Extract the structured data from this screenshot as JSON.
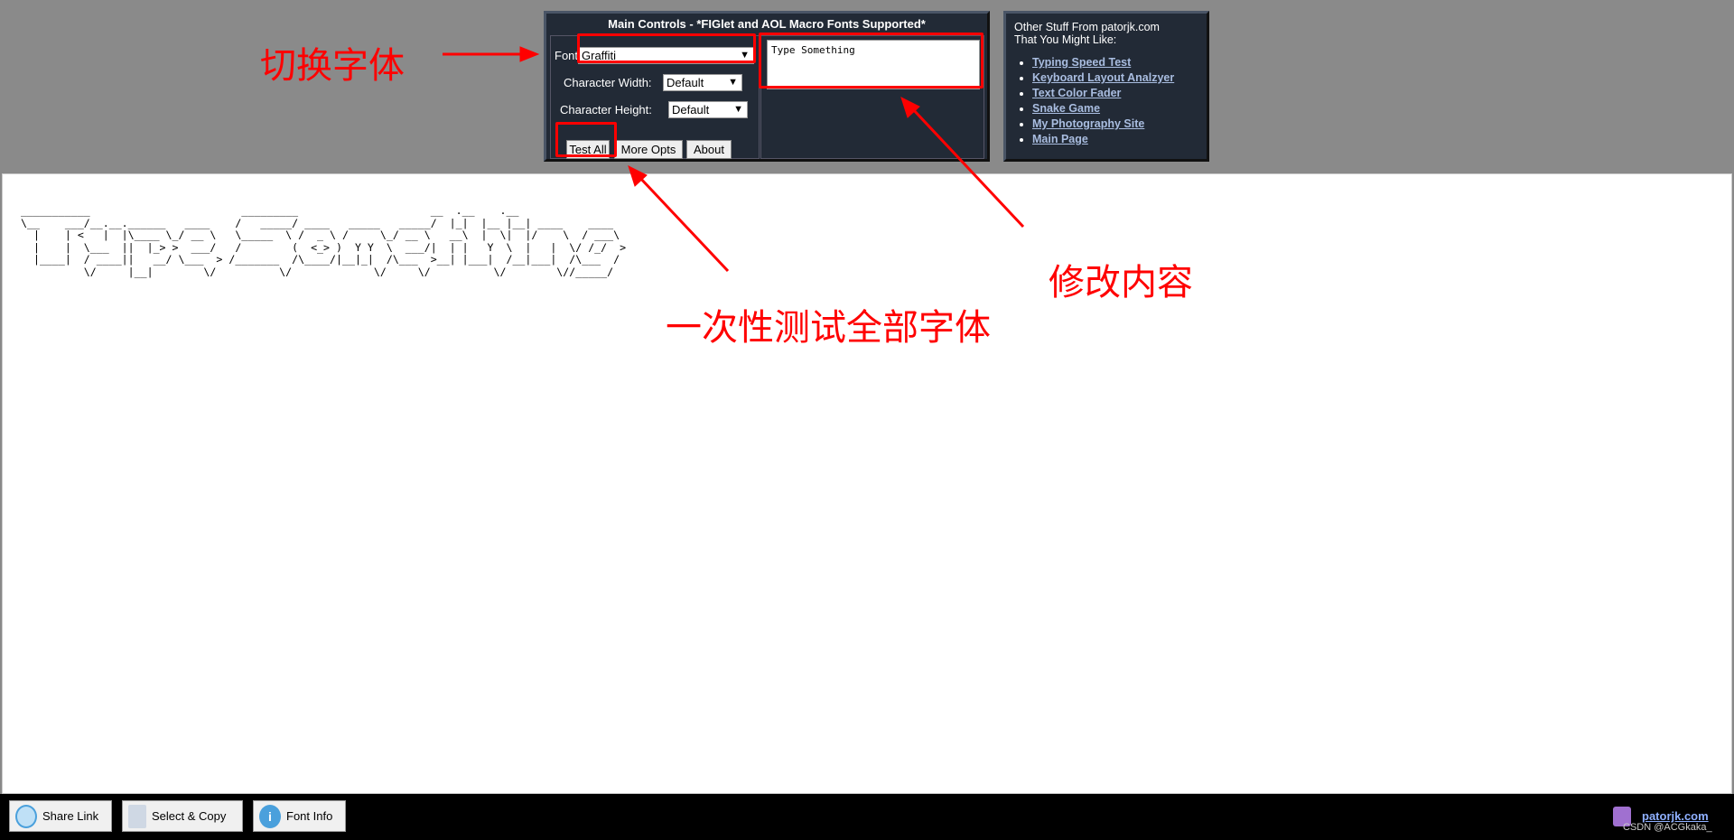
{
  "main_controls": {
    "title": "Main Controls - *FIGlet and AOL Macro Fonts Supported*",
    "font_label": "Font:",
    "font_value": "Graffiti",
    "char_width_label": "Character Width:",
    "char_width_value": "Default",
    "char_height_label": "Character Height:",
    "char_height_value": "Default",
    "buttons": [
      "Test All",
      "More Opts",
      "About"
    ],
    "input_text": "Type Something"
  },
  "other_stuff": {
    "heading_line1": "Other Stuff From patorjk.com",
    "heading_line2": "That You Might Like:",
    "links": [
      "Typing Speed Test",
      "Keyboard Layout Analzyer",
      "Text Color Fader",
      "Snake Game",
      "My Photography Site",
      "Main Page"
    ]
  },
  "output_art": "___________                        _________                     __  .__    .__\n\\__    ___/__.__.______   ____    /   _____/ ____   _____   _____/  |_|  |__ |__| ____    ____\n  |    | <   |  |\\____ \\_/ __ \\   \\_____  \\ /  _ \\ /     \\_/ __ \\   __\\  |  \\|  |/    \\  / ___\\\n  |    |  \\___  ||  |_> >  ___/   /        (  <_> )  Y Y  \\  ___/|  | |   Y  \\  |   |  \\/ /_/  >\n  |____|  / ____||   __/ \\___  > /_______  /\\____/|__|_|  /\\___  >__| |___|  /__|___|  /\\___  /\n          \\/     |__|        \\/          \\/             \\/     \\/          \\/        \\//_____/",
  "footer": {
    "buttons": [
      "Share Link",
      "Select & Copy",
      "Font Info"
    ],
    "logo_text": "patorjk.com",
    "watermark": "CSDN @ACGkaka_"
  },
  "annotations": {
    "switch_font": "切换字体",
    "edit_content": "修改内容",
    "test_all_fonts": "一次性测试全部字体",
    "color": "#ff0000"
  }
}
